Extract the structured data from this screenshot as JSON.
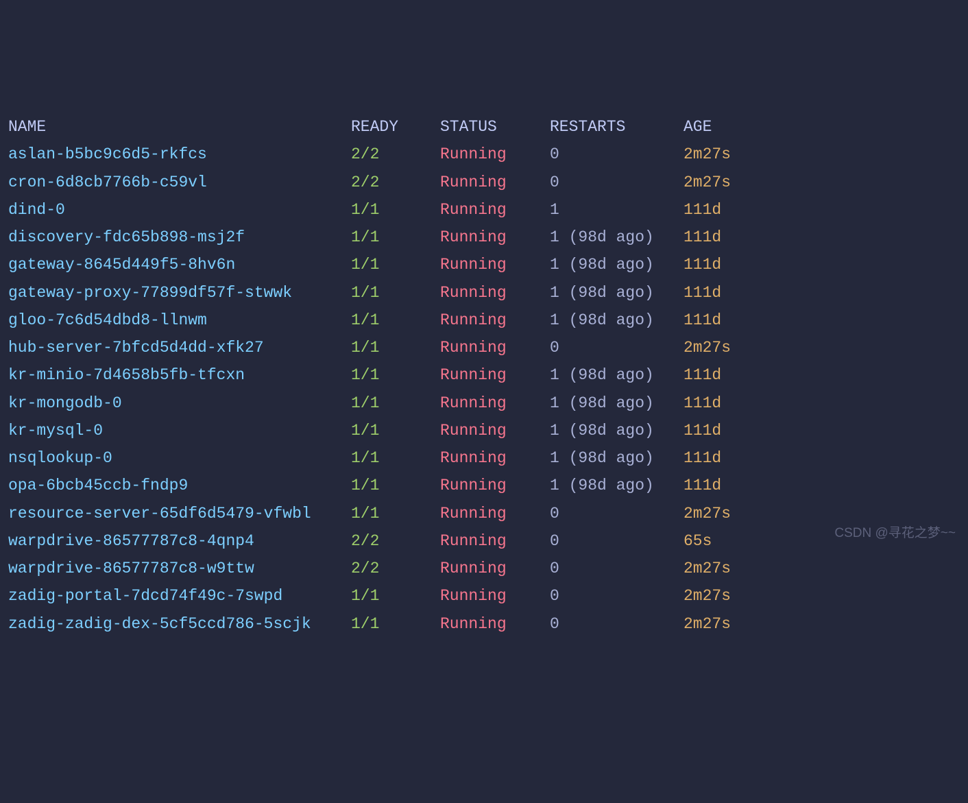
{
  "headers": {
    "name": "NAME",
    "ready": "READY",
    "status": "STATUS",
    "restarts": "RESTARTS",
    "age": "AGE"
  },
  "pods": [
    {
      "name": "aslan-b5bc9c6d5-rkfcs",
      "ready": "2/2",
      "status": "Running",
      "restarts": "0",
      "age": "2m27s"
    },
    {
      "name": "cron-6d8cb7766b-c59vl",
      "ready": "2/2",
      "status": "Running",
      "restarts": "0",
      "age": "2m27s"
    },
    {
      "name": "dind-0",
      "ready": "1/1",
      "status": "Running",
      "restarts": "1",
      "age": "111d"
    },
    {
      "name": "discovery-fdc65b898-msj2f",
      "ready": "1/1",
      "status": "Running",
      "restarts": "1 (98d ago)",
      "age": "111d"
    },
    {
      "name": "gateway-8645d449f5-8hv6n",
      "ready": "1/1",
      "status": "Running",
      "restarts": "1 (98d ago)",
      "age": "111d"
    },
    {
      "name": "gateway-proxy-77899df57f-stwwk",
      "ready": "1/1",
      "status": "Running",
      "restarts": "1 (98d ago)",
      "age": "111d"
    },
    {
      "name": "gloo-7c6d54dbd8-llnwm",
      "ready": "1/1",
      "status": "Running",
      "restarts": "1 (98d ago)",
      "age": "111d"
    },
    {
      "name": "hub-server-7bfcd5d4dd-xfk27",
      "ready": "1/1",
      "status": "Running",
      "restarts": "0",
      "age": "2m27s"
    },
    {
      "name": "kr-minio-7d4658b5fb-tfcxn",
      "ready": "1/1",
      "status": "Running",
      "restarts": "1 (98d ago)",
      "age": "111d"
    },
    {
      "name": "kr-mongodb-0",
      "ready": "1/1",
      "status": "Running",
      "restarts": "1 (98d ago)",
      "age": "111d"
    },
    {
      "name": "kr-mysql-0",
      "ready": "1/1",
      "status": "Running",
      "restarts": "1 (98d ago)",
      "age": "111d"
    },
    {
      "name": "nsqlookup-0",
      "ready": "1/1",
      "status": "Running",
      "restarts": "1 (98d ago)",
      "age": "111d"
    },
    {
      "name": "opa-6bcb45ccb-fndp9",
      "ready": "1/1",
      "status": "Running",
      "restarts": "1 (98d ago)",
      "age": "111d"
    },
    {
      "name": "resource-server-65df6d5479-vfwbl",
      "ready": "1/1",
      "status": "Running",
      "restarts": "0",
      "age": "2m27s"
    },
    {
      "name": "warpdrive-86577787c8-4qnp4",
      "ready": "2/2",
      "status": "Running",
      "restarts": "0",
      "age": "65s"
    },
    {
      "name": "warpdrive-86577787c8-w9ttw",
      "ready": "2/2",
      "status": "Running",
      "restarts": "0",
      "age": "2m27s"
    },
    {
      "name": "zadig-portal-7dcd74f49c-7swpd",
      "ready": "1/1",
      "status": "Running",
      "restarts": "0",
      "age": "2m27s"
    },
    {
      "name": "zadig-zadig-dex-5cf5ccd786-5scjk",
      "ready": "1/1",
      "status": "Running",
      "restarts": "0",
      "age": "2m27s"
    }
  ],
  "watermark": "CSDN @寻花之梦~~"
}
